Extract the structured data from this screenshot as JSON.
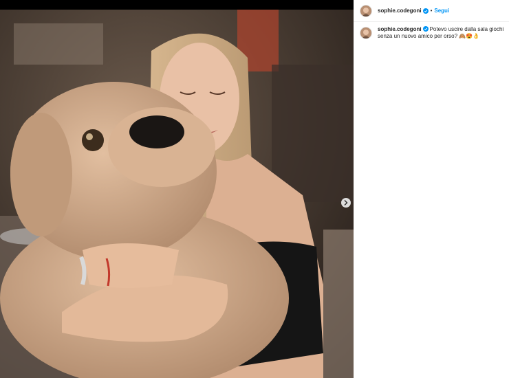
{
  "post": {
    "username": "sophie.codegoni",
    "dot": "•",
    "follow_label": "Segui",
    "caption": "Potevo uscire dalla sala giochi senza un nuovo amico per orso?",
    "caption_emoji": "🙈😍👌"
  },
  "icons": {
    "verified": "verified-badge-icon",
    "next": "chevron-right-icon"
  },
  "colors": {
    "follow": "#0095f6",
    "verified": "#0095f6",
    "text": "#262626"
  }
}
